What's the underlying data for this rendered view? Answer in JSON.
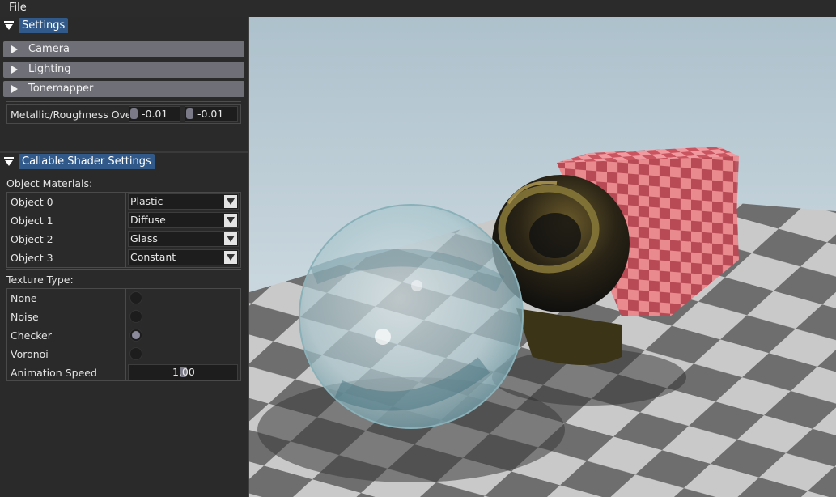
{
  "menubar": {
    "file": "File"
  },
  "settings": {
    "title": "Settings",
    "sections": [
      {
        "label": "Camera"
      },
      {
        "label": "Lighting"
      },
      {
        "label": "Tonemapper"
      }
    ],
    "override": {
      "label": "Metallic/Roughness Ove",
      "metallic": "-0.01",
      "roughness": "-0.01"
    }
  },
  "callable": {
    "title": "Callable Shader Settings",
    "materials_label": "Object Materials:",
    "objects": [
      {
        "label": "Object 0",
        "value": "Plastic"
      },
      {
        "label": "Object 1",
        "value": "Diffuse"
      },
      {
        "label": "Object 2",
        "value": "Glass"
      },
      {
        "label": "Object 3",
        "value": "Constant"
      }
    ],
    "texture_label": "Texture Type:",
    "textures": [
      {
        "label": "None",
        "selected": false
      },
      {
        "label": "Noise",
        "selected": false
      },
      {
        "label": "Checker",
        "selected": true
      },
      {
        "label": "Voronoi",
        "selected": false
      }
    ],
    "animation": {
      "label": "Animation Speed",
      "value": "1.00",
      "fraction": 0.5
    }
  },
  "colors": {
    "title_tab": "#315a8a",
    "section_header": "#6f6f78",
    "panel": "#2a2a2a",
    "checker_red": "#c95560",
    "checker_pink": "#e98a8f"
  }
}
